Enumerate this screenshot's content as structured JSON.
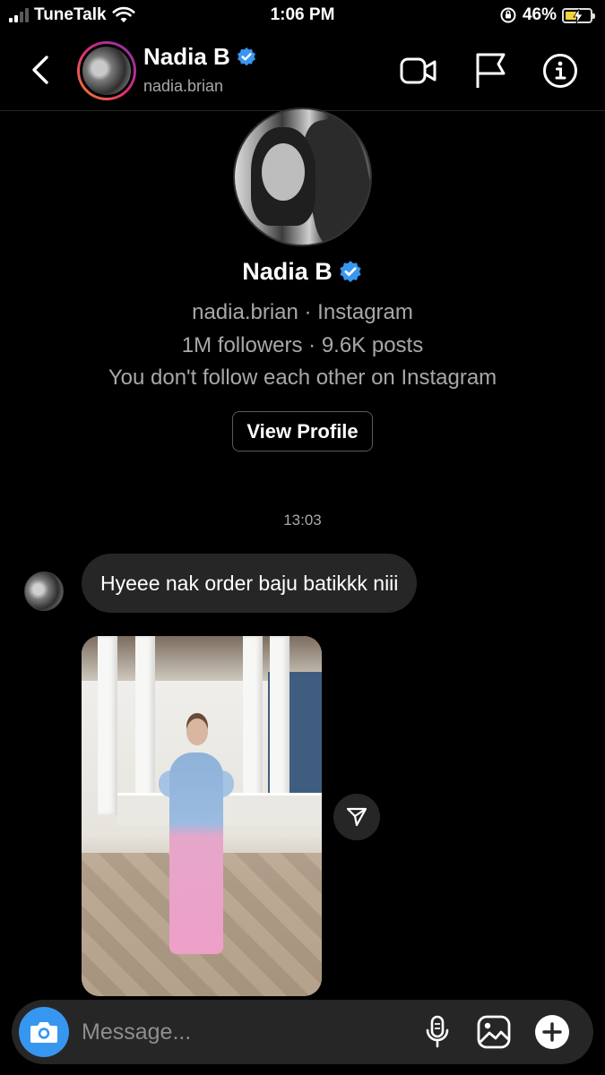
{
  "status_bar": {
    "carrier": "TuneTalk",
    "time": "1:06 PM",
    "battery_percent": "46%",
    "battery_level": 0.46,
    "icons": [
      "signal-icon",
      "wifi-icon",
      "orientation-lock-icon",
      "battery-charging-icon"
    ]
  },
  "header": {
    "name": "Nadia B",
    "username": "nadia.brian",
    "verified": true,
    "icons": [
      "back-chevron-icon",
      "video-call-icon",
      "flag-icon",
      "info-icon"
    ]
  },
  "profile": {
    "name": "Nadia B",
    "username_source": "nadia.brian · Instagram",
    "stats": "1M followers · 9.6K posts",
    "relationship": "You don't follow each other on Instagram",
    "view_profile_label": "View Profile"
  },
  "thread": {
    "timestamp": "13:03",
    "messages": [
      {
        "type": "text",
        "text": "Hyeee nak order baju batikkk niii"
      },
      {
        "type": "image",
        "alt": ""
      }
    ]
  },
  "composer": {
    "placeholder": "Message...",
    "icons": [
      "camera-icon",
      "microphone-icon",
      "gallery-icon",
      "add-icon"
    ]
  },
  "colors": {
    "background": "#000000",
    "bubble": "#262626",
    "accent": "#3797f0",
    "verified": "#3897f0",
    "secondary_text": "#a8a8a8"
  }
}
